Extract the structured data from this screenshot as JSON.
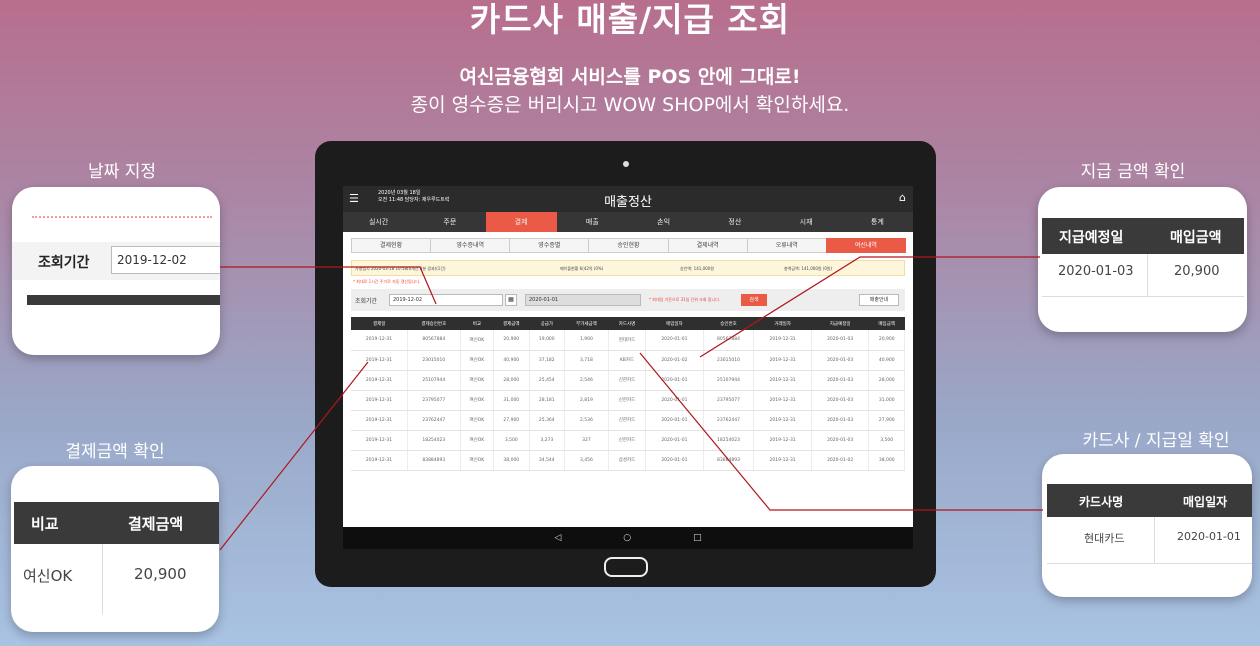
{
  "hero": {
    "title": "카드사 매출/지급 조회",
    "line1": "여신금융협회 서비스를 POS 안에 그대로!",
    "line2": "종이 영수증은 버리시고 WOW SHOP에서 확인하세요."
  },
  "callouts": {
    "date": "날짜 지정",
    "amount": "결제금액 확인",
    "payout": "지급 금액 확인",
    "card": "카드사 / 지급일 확인"
  },
  "card_date": {
    "label": "조회기간",
    "value": "2019-12-02"
  },
  "card_amount": {
    "headers": [
      "비교",
      "결제금액"
    ],
    "values": [
      "여신OK",
      "20,900"
    ]
  },
  "card_payout": {
    "headers": [
      "지급예정일",
      "매입금액"
    ],
    "values": [
      "2020-01-03",
      "20,900"
    ]
  },
  "card_issuer": {
    "headers": [
      "카드사명",
      "매입일자"
    ],
    "values": [
      "현대카드",
      "2020-01-01"
    ]
  },
  "screen": {
    "datetime_line1": "2020년 03월 18일",
    "datetime_line2": "오전 11:48  담당자: 제우루드트럭",
    "title": "매출정산",
    "main_tabs": [
      "실시간",
      "주문",
      "결제",
      "매출",
      "손익",
      "정산",
      "시재",
      "통계"
    ],
    "active_main_tab": "결제",
    "sub_tabs": [
      "결제현황",
      "영수증내역",
      "영수증별",
      "승인현황",
      "결제내역",
      "오류내역",
      "여신내역"
    ],
    "active_sub_tab": "여신내역",
    "notice": [
      "가맹점시 2020-03-18 10:58(0개건 3분 경과)(1건)",
      "메이플현황 6(42억 (0%)",
      "승인액: 141,000원",
      "총액금액: 141,000원 (0원)"
    ],
    "red_note": "* 최대로 1시간 주기로 자동 갱신됩니다.",
    "filter": {
      "label": "조회기간",
      "start": "2019-12-02",
      "end": "2020-01-01",
      "hint": "* 최대일 기준으로 31일 단위 조회 합니다.",
      "search": "검색",
      "guide": "매출안내"
    },
    "columns": [
      "결제일",
      "결제승인번호",
      "비교",
      "결제금액",
      "공급가",
      "부가세금액",
      "카드사명",
      "매입일자",
      "승인번호",
      "거래일자",
      "지급예정일",
      "매입금액"
    ],
    "rows": [
      [
        "2019-12-31",
        "80567884",
        "여신OK",
        "20,900",
        "19,000",
        "1,900",
        "현대카드",
        "2020-01-01",
        "80567884",
        "2019-12-31",
        "2020-01-03",
        "20,900"
      ],
      [
        "2019-12-31",
        "23015010",
        "여신OK",
        "40,900",
        "37,182",
        "3,718",
        "KB카드",
        "2020-01-02",
        "23015010",
        "2019-12-31",
        "2020-01-03",
        "40,900"
      ],
      [
        "2019-12-31",
        "25107944",
        "여신OK",
        "28,000",
        "25,454",
        "2,546",
        "신한카드",
        "2020-01-01",
        "25107944",
        "2019-12-31",
        "2020-01-03",
        "28,000"
      ],
      [
        "2019-12-31",
        "23795077",
        "여신OK",
        "31,000",
        "28,181",
        "2,819",
        "신한카드",
        "2020-01-01",
        "23795077",
        "2019-12-31",
        "2020-01-03",
        "31,000"
      ],
      [
        "2019-12-31",
        "23762447",
        "여신OK",
        "27,900",
        "25,364",
        "2,536",
        "신한카드",
        "2020-01-01",
        "23762447",
        "2019-12-31",
        "2020-01-03",
        "27,900"
      ],
      [
        "2019-12-31",
        "18254023",
        "여신OK",
        "3,500",
        "3,273",
        "327",
        "신한카드",
        "2020-01-01",
        "18254023",
        "2019-12-31",
        "2020-01-03",
        "3,500"
      ],
      [
        "2019-12-31",
        "83884893",
        "여신OK",
        "38,000",
        "34,544",
        "3,456",
        "삼성카드",
        "2020-01-01",
        "83884893",
        "2019-12-31",
        "2020-01-02",
        "38,000"
      ]
    ],
    "nav": {
      "back": "◁",
      "home": "○",
      "recent": "□"
    }
  },
  "colors": {
    "accent": "#ea5a47",
    "header_dark": "#2f2f2f",
    "leader_line": "#b0151d"
  },
  "icons": {
    "menu": "hamburger-menu-icon",
    "home": "home-icon",
    "calendar": "calendar-icon"
  }
}
